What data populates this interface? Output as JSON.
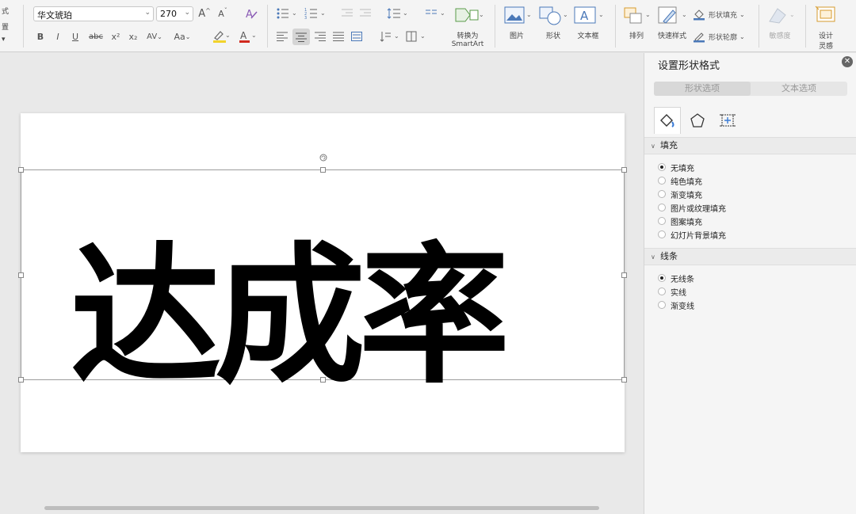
{
  "ribbon": {
    "left_edge_labels": [
      "式",
      "置",
      "▾"
    ],
    "font_name": "华文琥珀",
    "font_size": "270",
    "convert_smartart": [
      "转换为",
      "SmartArt"
    ],
    "picture_label": "图片",
    "shape_label": "形状",
    "textbox_label": "文本框",
    "arrange_label": "排列",
    "quick_style_label": "快速样式",
    "shape_fill_label": "形状填充",
    "shape_outline_label": "形状轮廓",
    "sensitivity_label": "敏感度",
    "design_ideas_label": [
      "设计",
      "灵感"
    ],
    "format_buttons": [
      "B",
      "I",
      "U",
      "abc",
      "x²",
      "x₂",
      "AV",
      "Aa"
    ],
    "highlight_color": "#f2d32b",
    "font_color": "#d12a1f"
  },
  "slide": {
    "text": "达成率"
  },
  "panel": {
    "title": "设置形状格式",
    "close_glyph": "✕",
    "tabs": [
      "形状选项",
      "文本选项"
    ],
    "fill_section": {
      "header": "填充",
      "options": [
        {
          "label": "无填充",
          "selected": true
        },
        {
          "label": "纯色填充",
          "selected": false
        },
        {
          "label": "渐变填充",
          "selected": false
        },
        {
          "label": "图片或纹理填充",
          "selected": false
        },
        {
          "label": "图案填充",
          "selected": false
        },
        {
          "label": "幻灯片背景填充",
          "selected": false
        }
      ]
    },
    "line_section": {
      "header": "线条",
      "options": [
        {
          "label": "无线条",
          "selected": true
        },
        {
          "label": "实线",
          "selected": false
        },
        {
          "label": "渐变线",
          "selected": false
        }
      ]
    }
  }
}
